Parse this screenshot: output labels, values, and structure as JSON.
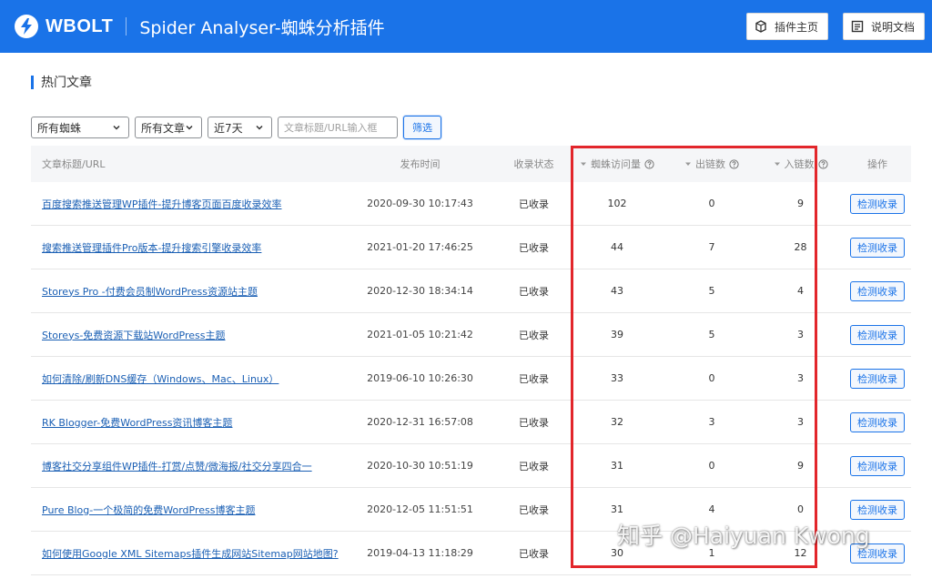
{
  "header": {
    "brand": "WBOLT",
    "app_title": "Spider Analyser-蜘蛛分析插件",
    "buttons": [
      {
        "label": "插件主页",
        "icon": "cube-icon"
      },
      {
        "label": "说明文档",
        "icon": "document-icon"
      }
    ]
  },
  "section": {
    "title": "热门文章"
  },
  "filters": {
    "spider_select": "所有蜘蛛",
    "article_select": "所有文章",
    "period_select": "近7天",
    "search_placeholder": "文章标题/URL输入框",
    "filter_button": "筛选"
  },
  "table": {
    "columns": {
      "title": "文章标题/URL",
      "date": "发布时间",
      "status": "收录状态",
      "spider_visits": "蜘蛛访问量",
      "outbound_links": "出链数",
      "inbound_links": "入链数",
      "actions": "操作"
    },
    "rows": [
      {
        "title": "百度搜索推送管理WP插件-提升博客页面百度收录效率",
        "date": "2020-09-30 10:17:43",
        "status": "已收录",
        "visits": "102",
        "out": "0",
        "in": "9",
        "action": "检测收录"
      },
      {
        "title": "搜索推送管理插件Pro版本-提升搜索引擎收录效率",
        "date": "2021-01-20 17:46:25",
        "status": "已收录",
        "visits": "44",
        "out": "7",
        "in": "28",
        "action": "检测收录"
      },
      {
        "title": "Storeys Pro -付费会员制WordPress资源站主题",
        "date": "2020-12-30 18:34:14",
        "status": "已收录",
        "visits": "43",
        "out": "5",
        "in": "4",
        "action": "检测收录"
      },
      {
        "title": "Storeys-免费资源下载站WordPress主题",
        "date": "2021-01-05 10:21:42",
        "status": "已收录",
        "visits": "39",
        "out": "5",
        "in": "3",
        "action": "检测收录"
      },
      {
        "title": "如何清除/刷新DNS缓存（Windows、Mac、Linux）",
        "date": "2019-06-10 10:26:30",
        "status": "已收录",
        "visits": "33",
        "out": "0",
        "in": "3",
        "action": "检测收录"
      },
      {
        "title": "RK Blogger-免费WordPress资讯博客主题",
        "date": "2020-12-31 16:57:08",
        "status": "已收录",
        "visits": "32",
        "out": "3",
        "in": "3",
        "action": "检测收录"
      },
      {
        "title": "博客社交分享组件WP插件-打赏/点赞/微海报/社交分享四合一",
        "date": "2020-10-30 10:51:19",
        "status": "已收录",
        "visits": "31",
        "out": "0",
        "in": "9",
        "action": "检测收录"
      },
      {
        "title": "Pure Blog-一个极简的免费WordPress博客主题",
        "date": "2020-12-05 11:51:51",
        "status": "已收录",
        "visits": "31",
        "out": "4",
        "in": "0",
        "action": "检测收录"
      },
      {
        "title": "如何使用Google XML Sitemaps插件生成网站Sitemap网站地图?",
        "date": "2019-04-13 11:18:29",
        "status": "已收录",
        "visits": "30",
        "out": "1",
        "in": "12",
        "action": "检测收录"
      }
    ]
  },
  "watermark": "知乎 @Haiyuan Kwong",
  "colors": {
    "brand_blue": "#1a73e8",
    "highlight_red": "#e2262b"
  }
}
